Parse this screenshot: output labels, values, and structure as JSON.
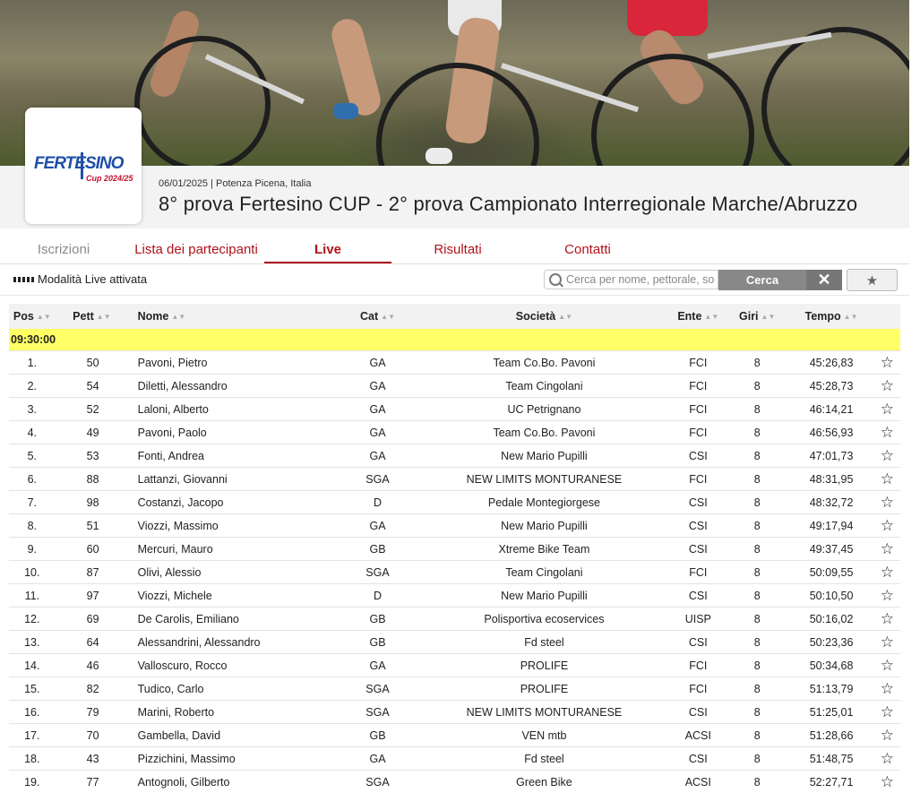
{
  "event": {
    "date": "06/01/2025",
    "location": "Potenza Picena, Italia",
    "title": "8° prova Fertesino CUP - 2° prova Campionato Interregionale Marche/Abruzzo",
    "logo_text": "FERTESINO",
    "logo_sub": "Cup 2024/25"
  },
  "tabs": [
    {
      "label": "Iscrizioni"
    },
    {
      "label": "Lista dei partecipanti"
    },
    {
      "label": "Live"
    },
    {
      "label": "Risultati"
    },
    {
      "label": "Contatti"
    }
  ],
  "toolbar": {
    "live_label": "Modalità Live attivata",
    "search_placeholder": "Cerca per nome, pettorale, so",
    "search_button": "Cerca",
    "clear_icon": "close-icon",
    "fav_icon": "star-icon"
  },
  "table": {
    "headers": {
      "pos": "Pos",
      "pett": "Pett",
      "nome": "Nome",
      "cat": "Cat",
      "societa": "Società",
      "ente": "Ente",
      "giri": "Giri",
      "tempo": "Tempo"
    },
    "wave": "09:30:00",
    "rows": [
      {
        "pos": "1.",
        "pett": "50",
        "nome": "Pavoni, Pietro",
        "cat": "GA",
        "soc": "Team Co.Bo. Pavoni",
        "ente": "FCI",
        "giri": "8",
        "tempo": "45:26,83"
      },
      {
        "pos": "2.",
        "pett": "54",
        "nome": "Diletti, Alessandro",
        "cat": "GA",
        "soc": "Team Cingolani",
        "ente": "FCI",
        "giri": "8",
        "tempo": "45:28,73"
      },
      {
        "pos": "3.",
        "pett": "52",
        "nome": "Laloni, Alberto",
        "cat": "GA",
        "soc": "UC Petrignano",
        "ente": "FCI",
        "giri": "8",
        "tempo": "46:14,21"
      },
      {
        "pos": "4.",
        "pett": "49",
        "nome": "Pavoni, Paolo",
        "cat": "GA",
        "soc": "Team Co.Bo. Pavoni",
        "ente": "FCI",
        "giri": "8",
        "tempo": "46:56,93"
      },
      {
        "pos": "5.",
        "pett": "53",
        "nome": "Fonti, Andrea",
        "cat": "GA",
        "soc": "New Mario Pupilli",
        "ente": "CSI",
        "giri": "8",
        "tempo": "47:01,73"
      },
      {
        "pos": "6.",
        "pett": "88",
        "nome": "Lattanzi, Giovanni",
        "cat": "SGA",
        "soc": "NEW LIMITS MONTURANESE",
        "ente": "FCI",
        "giri": "8",
        "tempo": "48:31,95"
      },
      {
        "pos": "7.",
        "pett": "98",
        "nome": "Costanzi, Jacopo",
        "cat": "D",
        "soc": "Pedale Montegiorgese",
        "ente": "CSI",
        "giri": "8",
        "tempo": "48:32,72"
      },
      {
        "pos": "8.",
        "pett": "51",
        "nome": "Viozzi, Massimo",
        "cat": "GA",
        "soc": "New Mario Pupilli",
        "ente": "CSI",
        "giri": "8",
        "tempo": "49:17,94"
      },
      {
        "pos": "9.",
        "pett": "60",
        "nome": "Mercuri, Mauro",
        "cat": "GB",
        "soc": "Xtreme Bike Team",
        "ente": "CSI",
        "giri": "8",
        "tempo": "49:37,45"
      },
      {
        "pos": "10.",
        "pett": "87",
        "nome": "Olivi, Alessio",
        "cat": "SGA",
        "soc": "Team Cingolani",
        "ente": "FCI",
        "giri": "8",
        "tempo": "50:09,55"
      },
      {
        "pos": "11.",
        "pett": "97",
        "nome": "Viozzi, Michele",
        "cat": "D",
        "soc": "New Mario Pupilli",
        "ente": "CSI",
        "giri": "8",
        "tempo": "50:10,50"
      },
      {
        "pos": "12.",
        "pett": "69",
        "nome": "De Carolis, Emiliano",
        "cat": "GB",
        "soc": "Polisportiva ecoservices",
        "ente": "UISP",
        "giri": "8",
        "tempo": "50:16,02"
      },
      {
        "pos": "13.",
        "pett": "64",
        "nome": "Alessandrini, Alessandro",
        "cat": "GB",
        "soc": "Fd steel",
        "ente": "CSI",
        "giri": "8",
        "tempo": "50:23,36"
      },
      {
        "pos": "14.",
        "pett": "46",
        "nome": "Valloscuro, Rocco",
        "cat": "GA",
        "soc": "PROLIFE",
        "ente": "FCI",
        "giri": "8",
        "tempo": "50:34,68"
      },
      {
        "pos": "15.",
        "pett": "82",
        "nome": "Tudico, Carlo",
        "cat": "SGA",
        "soc": "PROLIFE",
        "ente": "FCI",
        "giri": "8",
        "tempo": "51:13,79"
      },
      {
        "pos": "16.",
        "pett": "79",
        "nome": "Marini, Roberto",
        "cat": "SGA",
        "soc": "NEW LIMITS MONTURANESE",
        "ente": "CSI",
        "giri": "8",
        "tempo": "51:25,01"
      },
      {
        "pos": "17.",
        "pett": "70",
        "nome": "Gambella, David",
        "cat": "GB",
        "soc": "VEN mtb",
        "ente": "ACSI",
        "giri": "8",
        "tempo": "51:28,66"
      },
      {
        "pos": "18.",
        "pett": "43",
        "nome": "Pizzichini, Massimo",
        "cat": "GA",
        "soc": "Fd steel",
        "ente": "CSI",
        "giri": "8",
        "tempo": "51:48,75"
      },
      {
        "pos": "19.",
        "pett": "77",
        "nome": "Antognoli, Gilberto",
        "cat": "SGA",
        "soc": "Green Bike",
        "ente": "ACSI",
        "giri": "8",
        "tempo": "52:27,71"
      }
    ]
  },
  "colors": {
    "accent": "#b0121b",
    "wave_highlight": "#ffff66",
    "logo_blue": "#1f4fa8"
  }
}
